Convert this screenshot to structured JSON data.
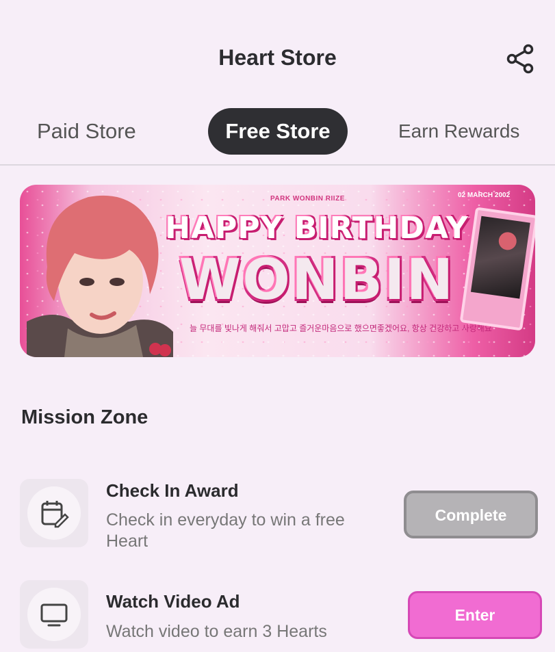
{
  "header": {
    "title": "Heart Store",
    "share_icon": "share-icon"
  },
  "tabs": [
    {
      "label": "Paid Store",
      "active": false
    },
    {
      "label": "Free Store",
      "active": true
    },
    {
      "label": "Earn Rewards",
      "active": false
    }
  ],
  "banner": {
    "small_text": "PARK WONBIN RIIZE",
    "date": "02 MARCH 2002",
    "headline": "HAPPY BIRTHDAY",
    "name": "WONBIN",
    "message": "늘 무대를 빛나게 해줘서 고맙고 즐거운마음으로 했으면좋겠어요, 항상 건강하고 사랑해요"
  },
  "mission_zone": {
    "title": "Mission Zone",
    "missions": [
      {
        "title": "Check In Award",
        "description": "Check in everyday to win a free Heart",
        "button": "Complete",
        "icon": "calendar-edit-icon",
        "status": "complete"
      },
      {
        "title": "Watch Video Ad",
        "description": "Watch video to earn 3 Hearts",
        "button": "Enter",
        "icon": "monitor-icon",
        "status": "available"
      }
    ]
  },
  "colors": {
    "accent_pink": "#f16cd2",
    "active_tab": "#2f2f33",
    "background": "#f7eef8",
    "disabled_button": "#b5b3b6"
  }
}
